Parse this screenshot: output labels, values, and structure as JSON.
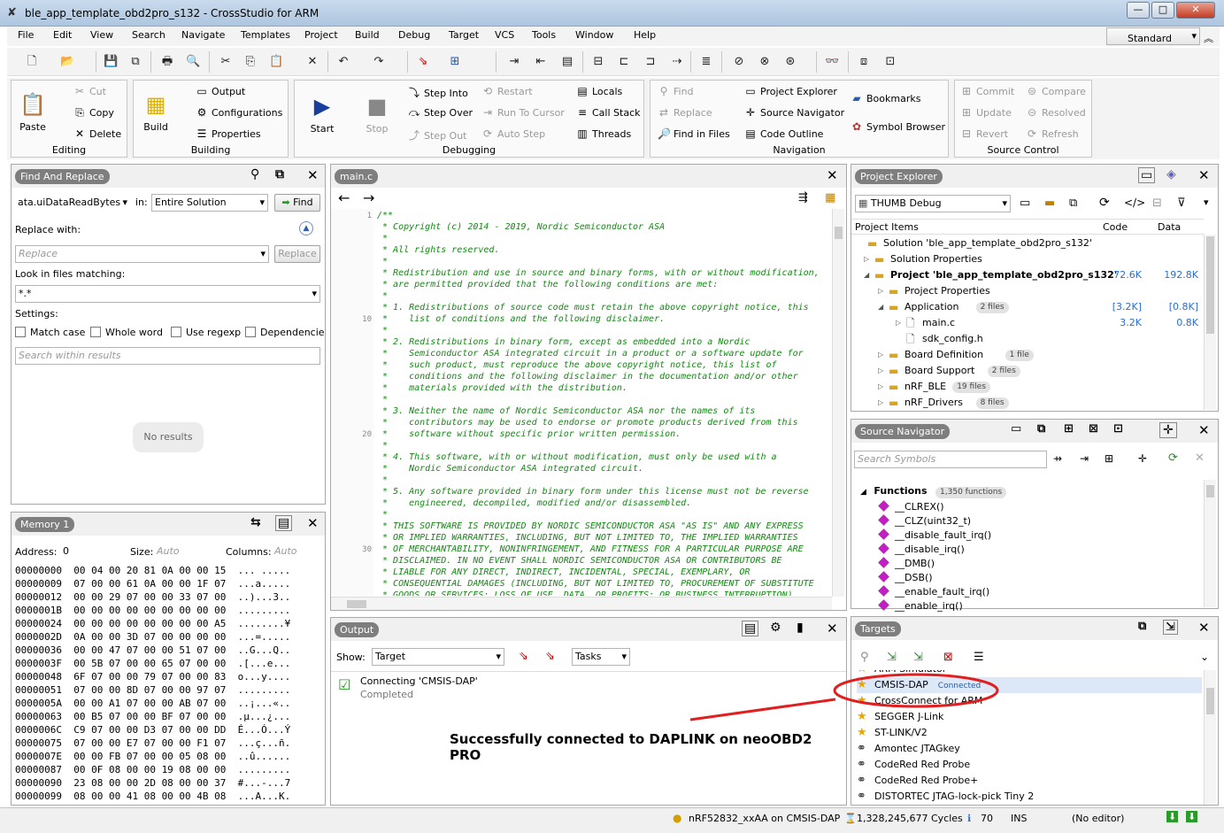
{
  "window": {
    "title": "ble_app_template_obd2pro_s132 - CrossStudio for ARM",
    "layout_mode": "Standard"
  },
  "menu": [
    "File",
    "Edit",
    "View",
    "Search",
    "Navigate",
    "Templates",
    "Project",
    "Build",
    "Debug",
    "Target",
    "VCS",
    "Tools",
    "Window",
    "Help"
  ],
  "ribbon": {
    "editing": {
      "label": "Editing",
      "paste": "Paste",
      "cut": "Cut",
      "copy": "Copy",
      "delete": "Delete"
    },
    "building": {
      "label": "Building",
      "build": "Build",
      "output": "Output",
      "configurations": "Configurations",
      "properties": "Properties"
    },
    "debugging": {
      "label": "Debugging",
      "start": "Start",
      "stop": "Stop",
      "step_into": "Step Into",
      "step_over": "Step Over",
      "step_out": "Step Out",
      "restart": "Restart",
      "run_to_cursor": "Run To Cursor",
      "auto_step": "Auto Step",
      "locals": "Locals",
      "call_stack": "Call Stack",
      "threads": "Threads"
    },
    "navigation": {
      "label": "Navigation",
      "find": "Find",
      "replace": "Replace",
      "find_in_files": "Find in Files",
      "project_explorer": "Project Explorer",
      "source_navigator": "Source Navigator",
      "code_outline": "Code Outline",
      "bookmarks": "Bookmarks",
      "symbol_browser": "Symbol Browser"
    },
    "source_control": {
      "label": "Source Control",
      "commit": "Commit",
      "update": "Update",
      "revert": "Revert",
      "compare": "Compare",
      "resolved": "Resolved",
      "refresh": "Refresh"
    }
  },
  "find_replace": {
    "tab": "Find And Replace",
    "search_value": "ata.uiDataReadBytes",
    "in_label": "in:",
    "scope": "Entire Solution",
    "find_btn": "Find",
    "replace_with": "Replace with:",
    "replace_placeholder": "Replace",
    "replace_btn": "Replace",
    "look_in": "Look in files matching:",
    "pattern": "*.*",
    "settings": "Settings:",
    "match_case": "Match case",
    "whole_word": "Whole word",
    "use_regexp": "Use regexp",
    "dependencies": "Dependencie",
    "search_results_placeholder": "Search within results",
    "no_results": "No results"
  },
  "memory": {
    "tab": "Memory 1",
    "address_label": "Address:",
    "address": "0",
    "size_label": "Size:",
    "size_placeholder": "Auto",
    "columns_label": "Columns:",
    "columns_placeholder": "Auto",
    "rows": [
      "00000000  00 04 00 20 81 0A 00 00 15  ... .....",
      "00000009  07 00 00 61 0A 00 00 1F 07  ...a.....",
      "00000012  00 00 29 07 00 00 33 07 00  ..)...3..",
      "0000001B  00 00 00 00 00 00 00 00 00  .........",
      "00000024  00 00 00 00 00 00 00 00 A5  ........¥",
      "0000002D  0A 00 00 3D 07 00 00 00 00  ...=.....",
      "00000036  00 00 47 07 00 00 51 07 00  ..G...Q..",
      "0000003F  00 5B 07 00 00 65 07 00 00  .[...e...",
      "00000048  6F 07 00 00 79 07 00 00 83  o...y....",
      "00000051  07 00 00 8D 07 00 00 97 07  .........",
      "0000005A  00 00 A1 07 00 00 AB 07 00  ..¡...«..",
      "00000063  00 B5 07 00 00 BF 07 00 00  .µ...¿...",
      "0000006C  C9 07 00 00 D3 07 00 00 DD  É...Ó...Ý",
      "00000075  07 00 00 E7 07 00 00 F1 07  ...ç...ñ.",
      "0000007E  00 00 FB 07 00 00 05 08 00  ..û......",
      "00000087  00 0F 08 00 00 19 08 00 00  .........",
      "00000090  23 08 00 00 2D 08 00 00 37  #...-...7",
      "00000099  08 00 00 41 08 00 00 4B 08  ...A...K."
    ]
  },
  "editor": {
    "tab": "main.c",
    "lines": [
      "/**",
      " * Copyright (c) 2014 - 2019, Nordic Semiconductor ASA",
      " *",
      " * All rights reserved.",
      " *",
      " * Redistribution and use in source and binary forms, with or without modification,",
      " * are permitted provided that the following conditions are met:",
      " *",
      " * 1. Redistributions of source code must retain the above copyright notice, this",
      " *    list of conditions and the following disclaimer.",
      " *",
      " * 2. Redistributions in binary form, except as embedded into a Nordic",
      " *    Semiconductor ASA integrated circuit in a product or a software update for",
      " *    such product, must reproduce the above copyright notice, this list of",
      " *    conditions and the following disclaimer in the documentation and/or other",
      " *    materials provided with the distribution.",
      " *",
      " * 3. Neither the name of Nordic Semiconductor ASA nor the names of its",
      " *    contributors may be used to endorse or promote products derived from this",
      " *    software without specific prior written permission.",
      " *",
      " * 4. This software, with or without modification, must only be used with a",
      " *    Nordic Semiconductor ASA integrated circuit.",
      " *",
      " * 5. Any software provided in binary form under this license must not be reverse",
      " *    engineered, decompiled, modified and/or disassembled.",
      " *",
      " * THIS SOFTWARE IS PROVIDED BY NORDIC SEMICONDUCTOR ASA \"AS IS\" AND ANY EXPRESS",
      " * OR IMPLIED WARRANTIES, INCLUDING, BUT NOT LIMITED TO, THE IMPLIED WARRANTIES",
      " * OF MERCHANTABILITY, NONINFRINGEMENT, AND FITNESS FOR A PARTICULAR PURPOSE ARE",
      " * DISCLAIMED. IN NO EVENT SHALL NORDIC SEMICONDUCTOR ASA OR CONTRIBUTORS BE",
      " * LIABLE FOR ANY DIRECT, INDIRECT, INCIDENTAL, SPECIAL, EXEMPLARY, OR",
      " * CONSEQUENTIAL DAMAGES (INCLUDING, BUT NOT LIMITED TO, PROCUREMENT OF SUBSTITUTE",
      " * GOODS OR SERVICES; LOSS OF USE, DATA, OR PROFITS; OR BUSINESS INTERRUPTION)"
    ],
    "line_numbers": [
      "1",
      "10",
      "20",
      "30"
    ]
  },
  "output": {
    "tab": "Output",
    "show_label": "Show:",
    "show_value": "Target",
    "tasks": "Tasks",
    "message": "Connecting 'CMSIS-DAP'",
    "status": "Completed",
    "annotation": "Successfully connected to DAPLINK on neoOBD2 PRO"
  },
  "project_explorer": {
    "tab": "Project Explorer",
    "config": "THUMB Debug",
    "col_items": "Project Items",
    "col_code": "Code",
    "col_data": "Data",
    "items": [
      {
        "label": "Solution 'ble_app_template_obd2pro_s132'",
        "code": "",
        "data": ""
      },
      {
        "label": "Solution Properties",
        "code": "",
        "data": ""
      },
      {
        "label": "Project 'ble_app_template_obd2pro_s132'",
        "code": "72.6K",
        "data": "192.8K"
      },
      {
        "label": "Project Properties",
        "code": "",
        "data": ""
      },
      {
        "label": "Application",
        "badge": "2 files",
        "code": "[3.2K]",
        "data": "[0.8K]"
      },
      {
        "label": "main.c",
        "code": "3.2K",
        "data": "0.8K"
      },
      {
        "label": "sdk_config.h",
        "code": "",
        "data": ""
      },
      {
        "label": "Board Definition",
        "badge": "1 file",
        "code": "",
        "data": ""
      },
      {
        "label": "Board Support",
        "badge": "2 files",
        "code": "",
        "data": ""
      },
      {
        "label": "nRF_BLE",
        "badge": "19 files",
        "code": "",
        "data": ""
      },
      {
        "label": "nRF_Drivers",
        "badge": "8 files",
        "code": "",
        "data": ""
      }
    ]
  },
  "source_navigator": {
    "tab": "Source Navigator",
    "search_placeholder": "Search Symbols",
    "functions_label": "Functions",
    "functions_count": "1,350 functions",
    "functions": [
      "__CLREX()",
      "__CLZ(uint32_t)",
      "__disable_fault_irq()",
      "__disable_irq()",
      "__DMB()",
      "__DSB()",
      "__enable_fault_irq()",
      "__enable_irq()"
    ]
  },
  "targets": {
    "tab": "Targets",
    "connected_badge": "Connected",
    "items": [
      "ARM Simulator",
      "CMSIS-DAP",
      "CrossConnect for ARM",
      "SEGGER J-Link",
      "ST-LINK/V2",
      "Amontec JTAGkey",
      "CodeRed Red Probe",
      "CodeRed Red Probe+",
      "DISTORTEC JTAG-lock-pick Tiny 2"
    ]
  },
  "status": {
    "target": "nRF52832_xxAA on CMSIS-DAP",
    "cycles": "1,328,245,677 Cycles",
    "count": "70",
    "ins": "INS",
    "editor": "(No editor)"
  },
  "colors": {
    "annotation_red": "#e02020",
    "comment_green": "#138a13",
    "tab_gray": "#7e7e7e"
  }
}
